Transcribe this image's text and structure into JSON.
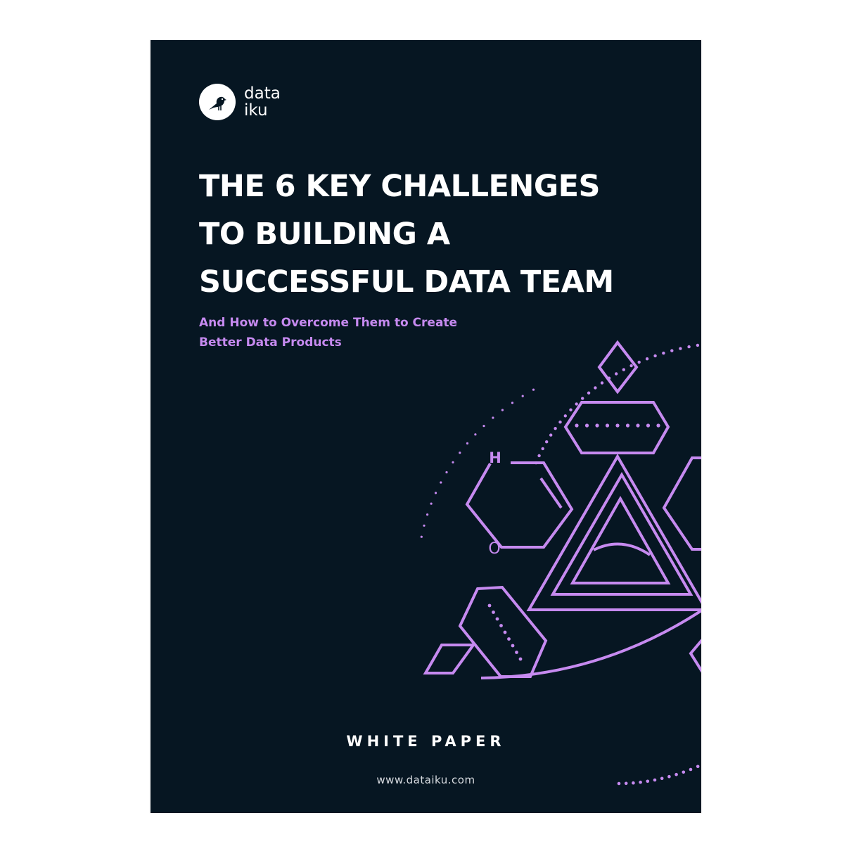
{
  "colors": {
    "background": "#ffffff",
    "cover": "#061622",
    "accent": "#c68af0",
    "text": "#ffffff"
  },
  "logo": {
    "icon": "bird-icon",
    "line1": "data",
    "line2": "iku"
  },
  "title": {
    "line1": "THE 6 KEY CHALLENGES",
    "line2": "TO BUILDING A",
    "line3": "SUCCESSFUL DATA TEAM"
  },
  "subtitle": {
    "line1": "And How to Overcome Them to Create",
    "line2": "Better Data Products"
  },
  "illustration": {
    "labels": {
      "h": "H",
      "o": "O"
    }
  },
  "doc_type": "WHITE PAPER",
  "website": "www.dataiku.com"
}
